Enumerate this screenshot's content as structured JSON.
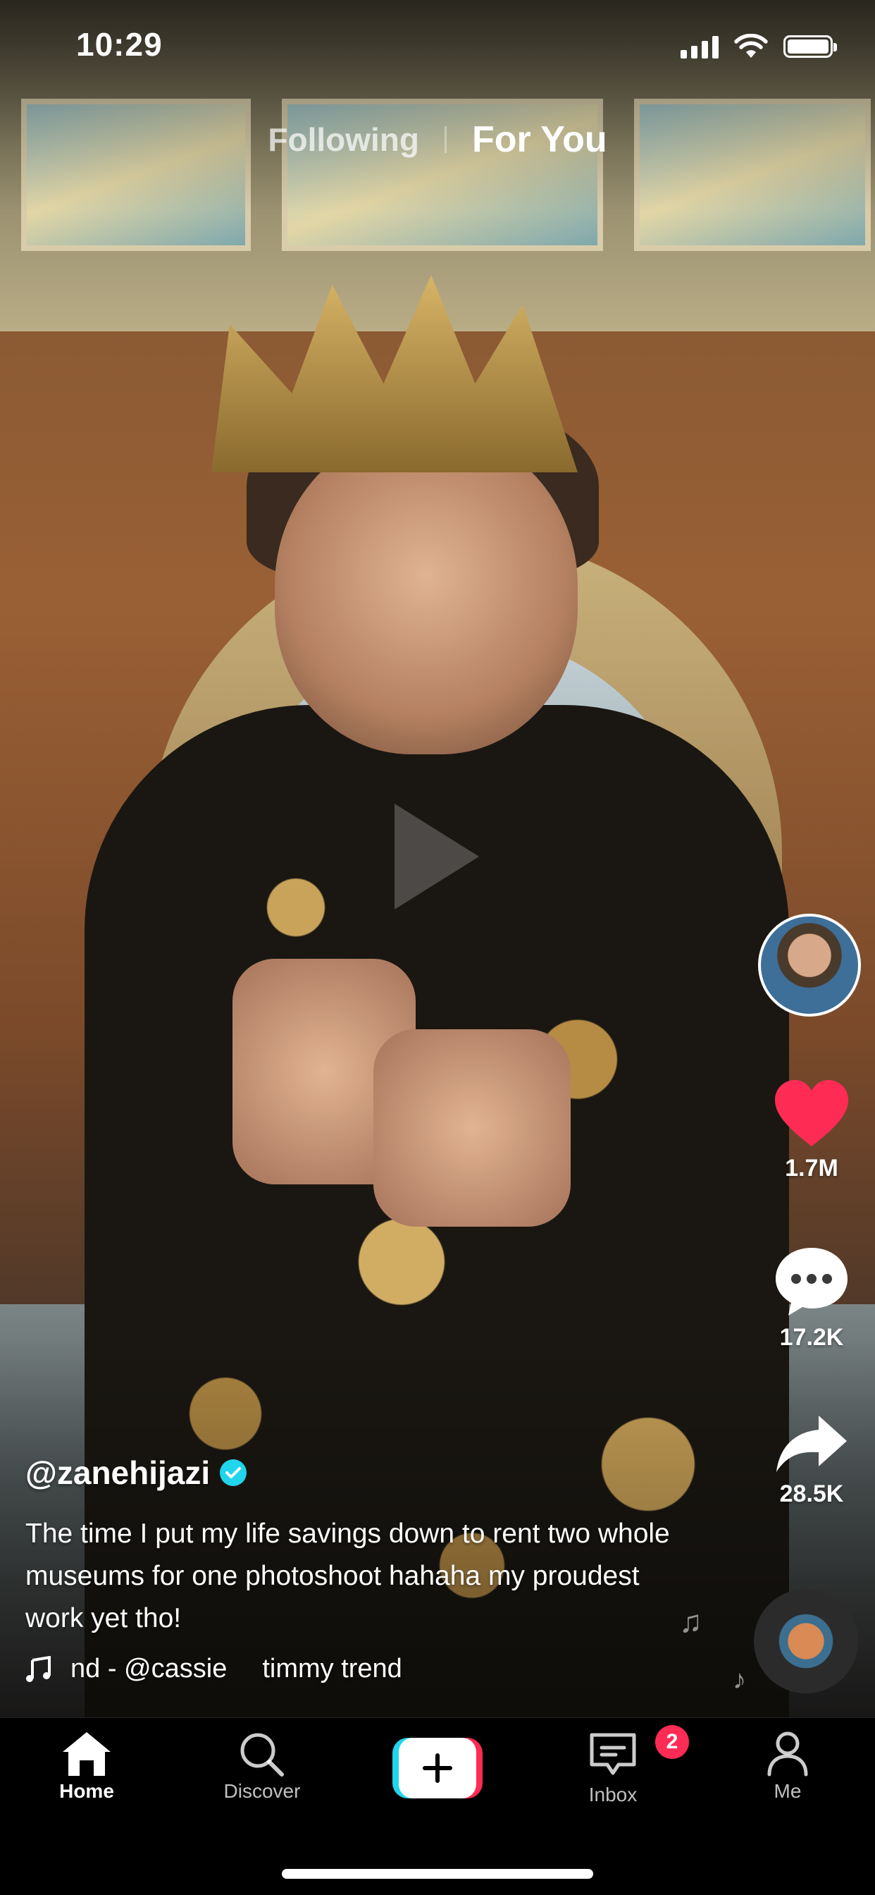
{
  "status_bar": {
    "time": "10:29"
  },
  "feed_tabs": {
    "following": "Following",
    "for_you": "For You"
  },
  "post": {
    "username": "@zanehijazi",
    "caption": "The time I put my life savings down to rent two whole museums for one photoshoot hahaha my proudest work yet tho!",
    "sound_part1": "nd - @cassie",
    "sound_part2": "timmy trend"
  },
  "actions": {
    "likes": "1.7M",
    "comments": "17.2K",
    "shares": "28.5K"
  },
  "nav": {
    "home": "Home",
    "discover": "Discover",
    "inbox": "Inbox",
    "me": "Me",
    "inbox_badge": "2"
  },
  "colors": {
    "like_red": "#fe2c55",
    "verified_cyan": "#20d5ec"
  }
}
